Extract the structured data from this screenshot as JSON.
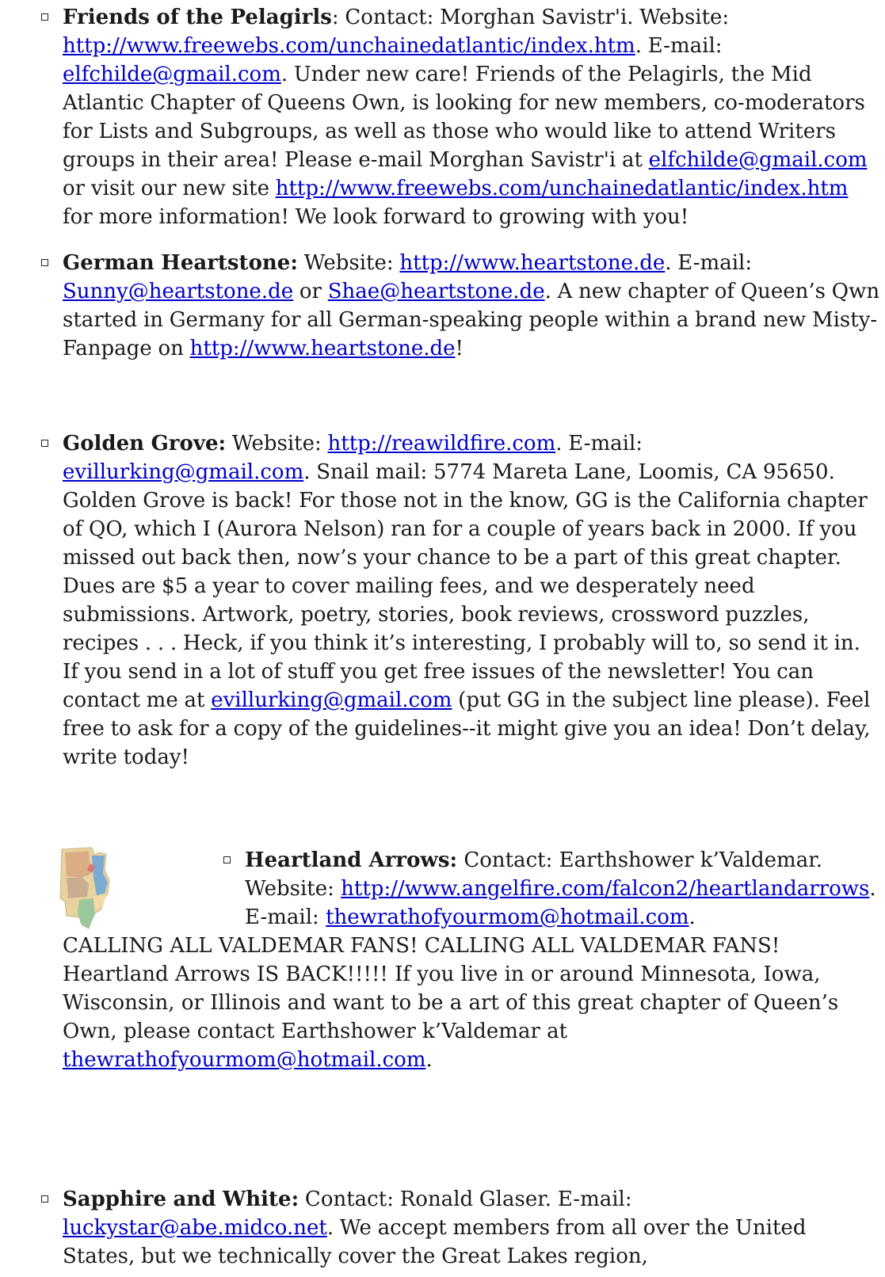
{
  "entries": {
    "pelagirls": {
      "name": "Friends of the Pelagirls",
      "p1": ":  Contact:  Morghan Savistr'i.  Website: ",
      "link_site": "http://www.freewebs.com/unchainedatlantic/index.htm",
      "p2": ".  E-mail: ",
      "link_email": "elfchilde@gmail.com",
      "p3": ".  Under new care! Friends of the Pelagirls, the Mid Atlantic Chapter of Queens Own, is looking for new members, co-moderators for Lists and Subgroups, as well as those who would like to attend Writers groups in their area! Please e-mail Morghan Savistr'i at ",
      "link_email2": "elfchilde@gmail.com",
      "p4": " or visit our new site ",
      "link_site2": "http://www.freewebs.com/unchainedatlantic/index.htm",
      "p5": " for more information! We look forward to growing with you!"
    },
    "heartstone": {
      "name": "German Heartstone:",
      "p1": "  Website: ",
      "link_site": "http://www.heartstone.de",
      "p2": ".  E-mail: ",
      "link_email1": "Sunny@heartstone.de",
      "p3": " or ",
      "link_email2": "Shae@heartstone.de",
      "p4": ". A new chapter of Queen’s Qwn started in Germany for all German-speaking people within a brand new Misty-Fanpage on ",
      "link_site2": "http://www.heartstone.de",
      "p5": "!"
    },
    "golden": {
      "name": "Golden Grove:",
      "p1": "  Website:  ",
      "link_site": "http://reawildfire.com",
      "p2": ".  E-mail: ",
      "link_email": "evillurking@gmail.com",
      "p3": ". Snail mail:  5774 Mareta Lane, Loomis, CA 95650.  Golden Grove is back!  For those not in the know, GG is the California chapter of QO, which I (Aurora Nelson) ran for a couple of years back in 2000.  If you missed out back then, now’s your chance to be a part of this great chapter.  Dues are $5 a year to cover mailing fees, and we desperately need submissions. Artwork, poetry, stories, book reviews, crossword puzzles, recipes . . . Heck, if you think it’s interesting, I probably will to, so send it in.  If you send in a lot of stuff you get free issues of the newsletter! You can contact me at ",
      "link_email2": "evillurking@gmail.com",
      "p4": " (put GG in the subject line please).  Feel free to ask for a copy of the guidelines--it might give you an idea!  Don’t delay, write today!"
    },
    "heartland": {
      "name": "Heartland Arrows:",
      "p1": "  Contact:  Earthshower k’Valdemar. Website: ",
      "link_site": "http://www.angelfire.com/falcon2/heartlandarrows",
      "p2": ". E-mail:  ",
      "link_email": "thewrathofyourmom@hotmail.com",
      "p3": ".",
      "rest1": "CALLING ALL VALDEMAR FANS!  CALLING ALL VALDEMAR FANS! Heartland Arrows IS BACK!!!!!  If you live in or around Minnesota, Iowa, Wisconsin, or Illinois and want to be a art of this great chapter of Queen’s Own, please contact Earthshower k’Valdemar at ",
      "link_email2": "thewrathofyourmom@hotmail.com",
      "rest2": "."
    },
    "sapphire": {
      "name": "Sapphire and White:",
      "p1": "  Contact:  Ronald Glaser.  E-mail: ",
      "link_email": "luckystar@abe.midco.net",
      "p2": ".  We accept members from all over the United States, but we technically cover the Great Lakes region,"
    }
  },
  "colors": {
    "link": "#0000cc",
    "text": "#1a1a1a"
  }
}
